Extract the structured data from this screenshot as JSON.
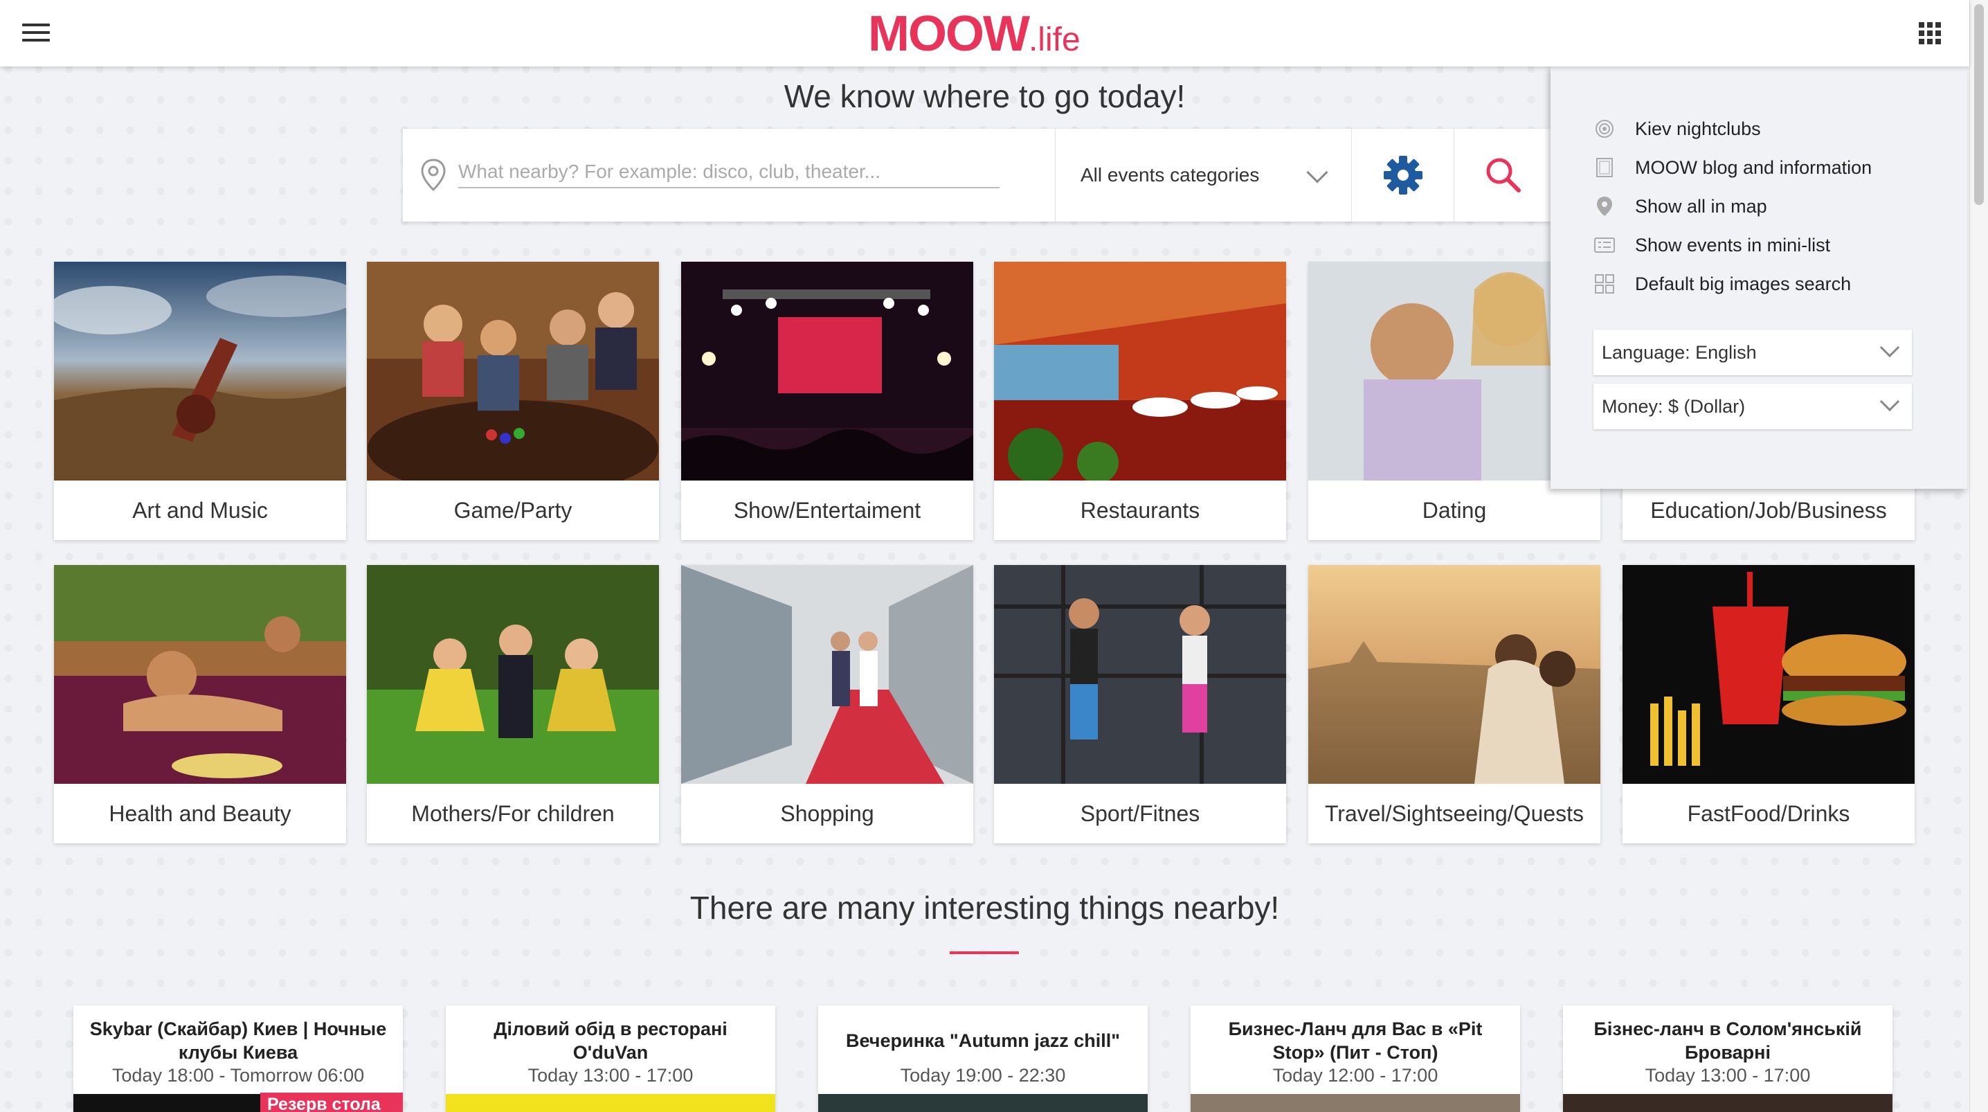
{
  "header": {
    "logo_main": "MOOW",
    "logo_sub": ".life"
  },
  "hero": {
    "title": "We know where to go today!"
  },
  "search": {
    "placeholder": "What nearby? For example: disco, club, theater...",
    "category": "All events categories"
  },
  "categories": [
    {
      "label": "Art and Music"
    },
    {
      "label": "Game/Party"
    },
    {
      "label": "Show/Entertaiment"
    },
    {
      "label": "Restaurants"
    },
    {
      "label": "Dating"
    },
    {
      "label": "Education/Job/Business"
    },
    {
      "label": "Health and Beauty"
    },
    {
      "label": "Mothers/For children"
    },
    {
      "label": "Shopping"
    },
    {
      "label": "Sport/Fitnes"
    },
    {
      "label": "Travel/Sightseeing/Quests"
    },
    {
      "label": "FastFood/Drinks"
    }
  ],
  "menu": {
    "items": [
      {
        "label": "Kiev nightclubs",
        "icon": "radio-waves-icon"
      },
      {
        "label": "MOOW blog and information",
        "icon": "document-icon"
      },
      {
        "label": "Show all in map",
        "icon": "map-pin-icon"
      },
      {
        "label": "Show events in mini-list",
        "icon": "list-card-icon"
      },
      {
        "label": "Default big images search",
        "icon": "grid-icon"
      }
    ],
    "language": "Language: English",
    "money": "Money: $ (Dollar)"
  },
  "nearby": {
    "title": "There are many interesting things nearby!"
  },
  "events": [
    {
      "title": "Skybar (Скайбар) Киев | Ночные клубы Киева",
      "time": "Today 18:00 - Tomorrow 06:00",
      "badge": "Резерв стола"
    },
    {
      "title": "Діловий обід в ресторані O'duVan",
      "time": "Today 13:00 - 17:00"
    },
    {
      "title": "Вечеринка \"Autumn jazz chill\"",
      "time": "Today 19:00 - 22:30"
    },
    {
      "title": "Бизнес-Ланч для Вас в «Pit Stop» (Пит - Стоп)",
      "time": "Today 12:00 - 17:00"
    },
    {
      "title": "Бізнес-ланч в Солом'янській Броварні",
      "time": "Today 13:00 - 17:00"
    }
  ],
  "colors": {
    "accent": "#e8345a",
    "background": "#f1f2f5",
    "gear": "#1e5aa0"
  }
}
